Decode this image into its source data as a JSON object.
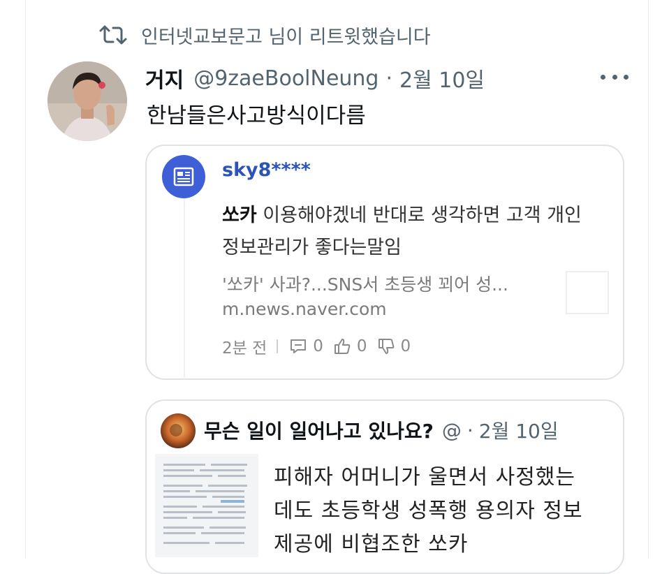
{
  "retweet": {
    "text": "인터넷교보문고 님이 리트윗했습니다"
  },
  "tweet": {
    "name": "거지",
    "handle": "@9zaeBoolNeung",
    "dot": "·",
    "date": "2월 10일",
    "text": "한남들은사고방식이다름"
  },
  "quote_card": {
    "username": "sky8****",
    "line1_bold": "쏘카",
    "line1_rest": " 이용해야겠네 반대로 생각하면 고객 개인",
    "line2": "정보관리가 좋다는말임",
    "link_title": "'쏘카' 사과?...SNS서 초등생 꾀어 성...",
    "link_domain": "m.news.naver.com",
    "time": "2분 전",
    "comments": "0",
    "likes": "0",
    "dislikes": "0"
  },
  "quote_tweet": {
    "name": "무슨 일이 일어나고 있나요?",
    "handle": "@",
    "dot": "·",
    "date": "2월 10일",
    "line1": "피해자 어머니가 울면서 사정했는",
    "line2": "데도 초등학생 성폭행 용의자 정보",
    "line3": "제공에 비협조한 쏘카"
  },
  "colors": {
    "secondary_text": "#536471",
    "naver_blue": "#3f5fd6",
    "username_blue": "#2c53b8",
    "border": "#dfe3e6"
  },
  "icons": [
    "retweet-icon",
    "more-icon",
    "naver-news-icon",
    "comment-icon",
    "like-icon",
    "dislike-icon"
  ]
}
